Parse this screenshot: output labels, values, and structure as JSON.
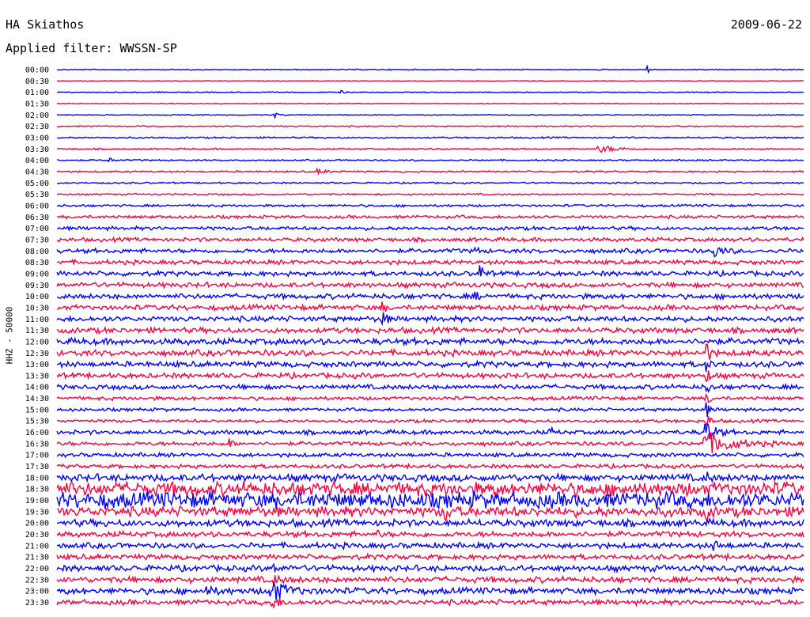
{
  "header": {
    "station": "HA Skiathos",
    "date": "2009-06-22",
    "filter": "Applied filter: WWSSN-SP"
  },
  "chart_data": {
    "type": "line",
    "title": "HA Skiathos",
    "ylabel": "HHZ - 50000",
    "colors": [
      "#0000ff",
      "#ff0040"
    ],
    "traces": [
      {
        "label": "00:00",
        "noise": 0.5,
        "events": [
          {
            "t": 0.79,
            "amp": 8,
            "dur": 0.003
          }
        ]
      },
      {
        "label": "00:30",
        "noise": 0.4,
        "events": []
      },
      {
        "label": "01:00",
        "noise": 0.5,
        "events": [
          {
            "t": 0.38,
            "amp": 2,
            "dur": 0.005
          }
        ]
      },
      {
        "label": "01:30",
        "noise": 0.4,
        "events": []
      },
      {
        "label": "02:00",
        "noise": 0.5,
        "events": [
          {
            "t": 0.29,
            "amp": 7,
            "dur": 0.003
          }
        ]
      },
      {
        "label": "02:30",
        "noise": 0.6,
        "events": []
      },
      {
        "label": "03:00",
        "noise": 0.8,
        "events": []
      },
      {
        "label": "03:30",
        "noise": 0.8,
        "events": [
          {
            "t": 0.73,
            "amp": 4,
            "dur": 0.02
          }
        ]
      },
      {
        "label": "04:00",
        "noise": 0.8,
        "events": [
          {
            "t": 0.07,
            "amp": 3,
            "dur": 0.005
          }
        ]
      },
      {
        "label": "04:30",
        "noise": 0.9,
        "events": [
          {
            "t": 0.35,
            "amp": 3,
            "dur": 0.01
          }
        ]
      },
      {
        "label": "05:00",
        "noise": 0.8,
        "events": []
      },
      {
        "label": "05:30",
        "noise": 0.8,
        "events": []
      },
      {
        "label": "06:00",
        "noise": 1.2,
        "events": []
      },
      {
        "label": "06:30",
        "noise": 1.6,
        "events": []
      },
      {
        "label": "07:00",
        "noise": 1.8,
        "events": []
      },
      {
        "label": "07:30",
        "noise": 2.0,
        "events": []
      },
      {
        "label": "08:00",
        "noise": 2.2,
        "events": [
          {
            "t": 0.88,
            "amp": 7,
            "dur": 0.01
          },
          {
            "t": 0.56,
            "amp": 5,
            "dur": 0.004
          }
        ]
      },
      {
        "label": "08:30",
        "noise": 2.2,
        "events": []
      },
      {
        "label": "09:00",
        "noise": 2.4,
        "events": [
          {
            "t": 0.565,
            "amp": 14,
            "dur": 0.005
          }
        ]
      },
      {
        "label": "09:30",
        "noise": 2.5,
        "events": []
      },
      {
        "label": "10:00",
        "noise": 2.6,
        "events": [
          {
            "t": 0.56,
            "amp": 6,
            "dur": 0.004
          }
        ]
      },
      {
        "label": "10:30",
        "noise": 2.6,
        "events": [
          {
            "t": 0.435,
            "amp": 6,
            "dur": 0.004
          }
        ]
      },
      {
        "label": "11:00",
        "noise": 2.7,
        "events": [
          {
            "t": 0.435,
            "amp": 10,
            "dur": 0.005
          }
        ]
      },
      {
        "label": "11:30",
        "noise": 2.8,
        "events": []
      },
      {
        "label": "12:00",
        "noise": 3.2,
        "events": [
          {
            "t": 0.87,
            "amp": 10,
            "dur": 0.004
          }
        ]
      },
      {
        "label": "12:30",
        "noise": 3.0,
        "events": [
          {
            "t": 0.87,
            "amp": 14,
            "dur": 0.004
          }
        ]
      },
      {
        "label": "13:00",
        "noise": 2.8,
        "events": [
          {
            "t": 0.87,
            "amp": 10,
            "dur": 0.004
          }
        ]
      },
      {
        "label": "13:30",
        "noise": 2.6,
        "events": [
          {
            "t": 0.87,
            "amp": 10,
            "dur": 0.004
          }
        ]
      },
      {
        "label": "14:00",
        "noise": 2.4,
        "events": [
          {
            "t": 0.87,
            "amp": 9,
            "dur": 0.004
          }
        ]
      },
      {
        "label": "14:30",
        "noise": 1.8,
        "events": [
          {
            "t": 0.87,
            "amp": 10,
            "dur": 0.004
          }
        ]
      },
      {
        "label": "15:00",
        "noise": 1.6,
        "events": [
          {
            "t": 0.87,
            "amp": 10,
            "dur": 0.004
          }
        ]
      },
      {
        "label": "15:30",
        "noise": 1.6,
        "events": [
          {
            "t": 0.87,
            "amp": 12,
            "dur": 0.004
          }
        ]
      },
      {
        "label": "16:00",
        "noise": 2.2,
        "events": [
          {
            "t": 0.87,
            "amp": 14,
            "dur": 0.01
          },
          {
            "t": 0.66,
            "amp": 5,
            "dur": 0.005
          }
        ]
      },
      {
        "label": "16:30",
        "noise": 2.0,
        "events": [
          {
            "t": 0.873,
            "amp": 13,
            "dur": 0.03
          },
          {
            "t": 0.23,
            "amp": 6,
            "dur": 0.005
          }
        ]
      },
      {
        "label": "17:00",
        "noise": 2.0,
        "events": []
      },
      {
        "label": "17:30",
        "noise": 2.0,
        "events": []
      },
      {
        "label": "18:00",
        "noise": 3.6,
        "events": [
          {
            "t": 0.87,
            "amp": 8,
            "dur": 0.004
          }
        ]
      },
      {
        "label": "18:30",
        "noise": 7.0,
        "events": []
      },
      {
        "label": "19:00",
        "noise": 8.0,
        "events": []
      },
      {
        "label": "19:30",
        "noise": 5.0,
        "events": [
          {
            "t": 0.52,
            "amp": 12,
            "dur": 0.004
          },
          {
            "t": 0.87,
            "amp": 8,
            "dur": 0.004
          }
        ]
      },
      {
        "label": "20:00",
        "noise": 3.6,
        "events": []
      },
      {
        "label": "20:30",
        "noise": 2.8,
        "events": [
          {
            "t": 0.43,
            "amp": 4,
            "dur": 0.004
          }
        ]
      },
      {
        "label": "21:00",
        "noise": 2.8,
        "events": [
          {
            "t": 0.88,
            "amp": 5,
            "dur": 0.008
          }
        ]
      },
      {
        "label": "21:30",
        "noise": 2.6,
        "events": []
      },
      {
        "label": "22:00",
        "noise": 3.0,
        "events": [
          {
            "t": 0.29,
            "amp": 4,
            "dur": 0.01
          }
        ]
      },
      {
        "label": "22:30",
        "noise": 3.0,
        "events": [
          {
            "t": 0.29,
            "amp": 5,
            "dur": 0.01
          }
        ]
      },
      {
        "label": "23:00",
        "noise": 3.2,
        "events": [
          {
            "t": 0.29,
            "amp": 12,
            "dur": 0.018
          },
          {
            "t": 0.2,
            "amp": 5,
            "dur": 0.01
          }
        ]
      },
      {
        "label": "23:30",
        "noise": 2.6,
        "events": [
          {
            "t": 0.29,
            "amp": 6,
            "dur": 0.01
          }
        ]
      }
    ]
  }
}
